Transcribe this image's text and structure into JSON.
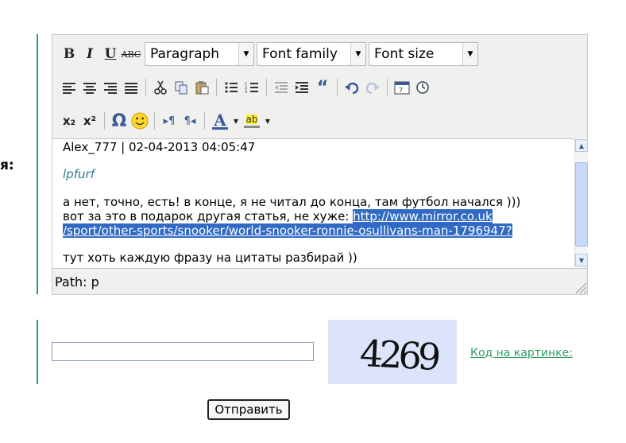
{
  "form": {
    "field_label_fragment": "я:",
    "submit_label": "Отправить"
  },
  "editor": {
    "toolbar": {
      "paragraph_select": "Paragraph",
      "font_family_select": "Font family",
      "font_size_select": "Font size",
      "bold": "B",
      "italic": "I",
      "underline": "U",
      "strikethrough": "ABC",
      "subscript": "x₂",
      "superscript": "x²",
      "blockquote": "“",
      "special_char": "Ω",
      "forecolor": "A",
      "backcolor": "ab"
    },
    "content": {
      "author": "Alex_777",
      "separator": " | ",
      "date": "02-04-2013 04:05:47",
      "quote_user": "lpfurf",
      "line1": " а нет, точно, есть! в конце, я не читал до конца, там футбол начался )))",
      "line2_prefix": "вот за это в подарок другая статья, не хуже: ",
      "link_part1": "http://www.mirror.co.uk",
      "link_part2": "/sport/other-sports/snooker/world-snooker-ronnie-osullivans-man-1796947?",
      "line3": "тут хоть каждую фразу на цитаты разбирай ))"
    },
    "path_label": "Path: p"
  },
  "captcha": {
    "code_text": "4269",
    "link_label": "Код на картинке:"
  },
  "colors": {
    "accent_green": "#2f9e62",
    "selection_blue": "#316ac5",
    "quote_user_teal": "#2a7f8f"
  }
}
